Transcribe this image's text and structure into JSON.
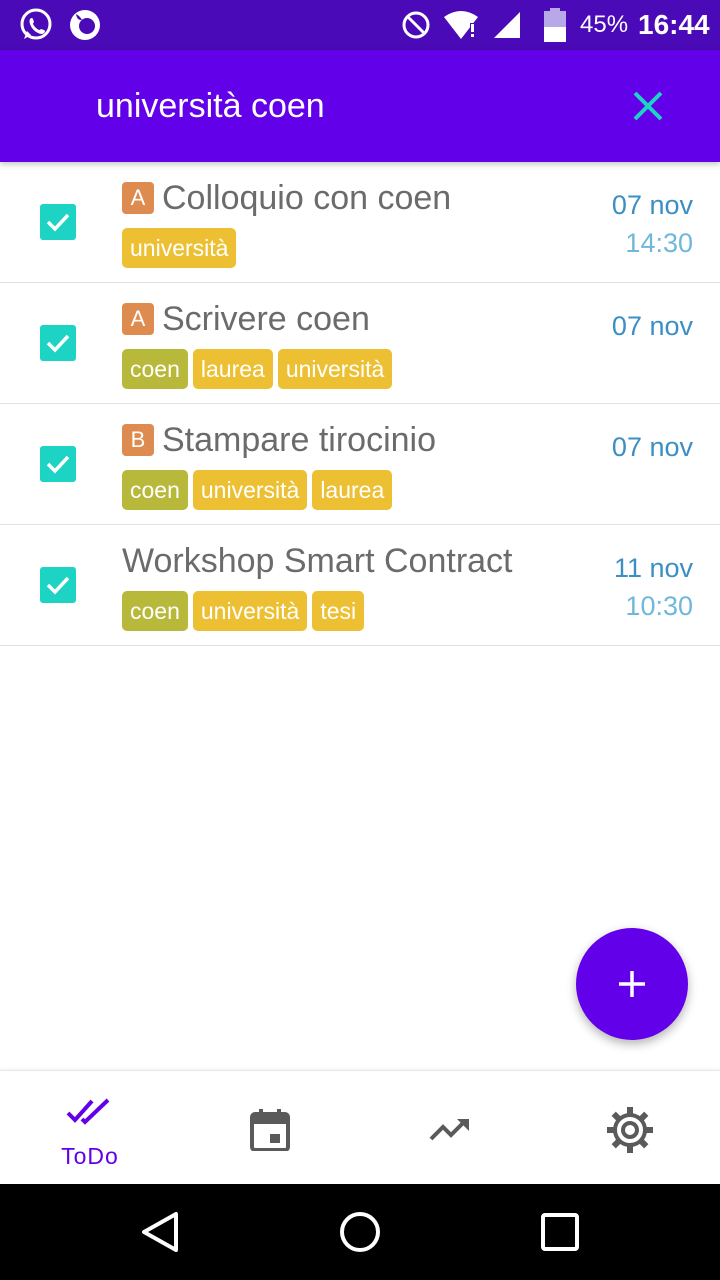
{
  "status_bar": {
    "battery": "45%",
    "time": "16:44",
    "icons": [
      "whatsapp-icon",
      "firefox-icon",
      "do-not-disturb-icon",
      "wifi-icon",
      "signal-icon",
      "battery-icon"
    ]
  },
  "search": {
    "query": "università coen",
    "clear_icon": "close-icon"
  },
  "tasks": [
    {
      "priority": "A",
      "title": "Colloquio con coen",
      "tags": [
        {
          "label": "università",
          "color": "#edc033"
        }
      ],
      "date": "07 nov",
      "time": "14:30",
      "checked": true
    },
    {
      "priority": "A",
      "title": "Scrivere coen",
      "tags": [
        {
          "label": "coen",
          "color": "#b8b83a"
        },
        {
          "label": "laurea",
          "color": "#edc033"
        },
        {
          "label": "università",
          "color": "#edc033"
        }
      ],
      "date": "07 nov",
      "time": "",
      "checked": true
    },
    {
      "priority": "B",
      "title": "Stampare tirocinio",
      "tags": [
        {
          "label": "coen",
          "color": "#b8b83a"
        },
        {
          "label": "università",
          "color": "#edc033"
        },
        {
          "label": "laurea",
          "color": "#edc033"
        }
      ],
      "date": "07 nov",
      "time": "",
      "checked": true
    },
    {
      "priority": "",
      "title": "Workshop Smart Contract",
      "tags": [
        {
          "label": "coen",
          "color": "#b8b83a"
        },
        {
          "label": "università",
          "color": "#edc033"
        },
        {
          "label": "tesi",
          "color": "#edc033"
        }
      ],
      "date": "11 nov",
      "time": "10:30",
      "checked": true
    }
  ],
  "fab": {
    "icon": "plus-icon"
  },
  "bottom_nav": {
    "items": [
      {
        "icon": "double-check-icon",
        "label": "ToDo",
        "active": true
      },
      {
        "icon": "calendar-icon",
        "label": "",
        "active": false
      },
      {
        "icon": "trending-up-icon",
        "label": "",
        "active": false
      },
      {
        "icon": "settings-icon",
        "label": "",
        "active": false
      }
    ]
  },
  "colors": {
    "primary": "#6200ea",
    "status_bar": "#4a0ab8",
    "accent": "#1dd3c4",
    "date": "#3b8fc4",
    "tag_olive": "#b8b83a",
    "tag_yellow": "#edc033",
    "priority_badge": "#dd8b4f"
  }
}
